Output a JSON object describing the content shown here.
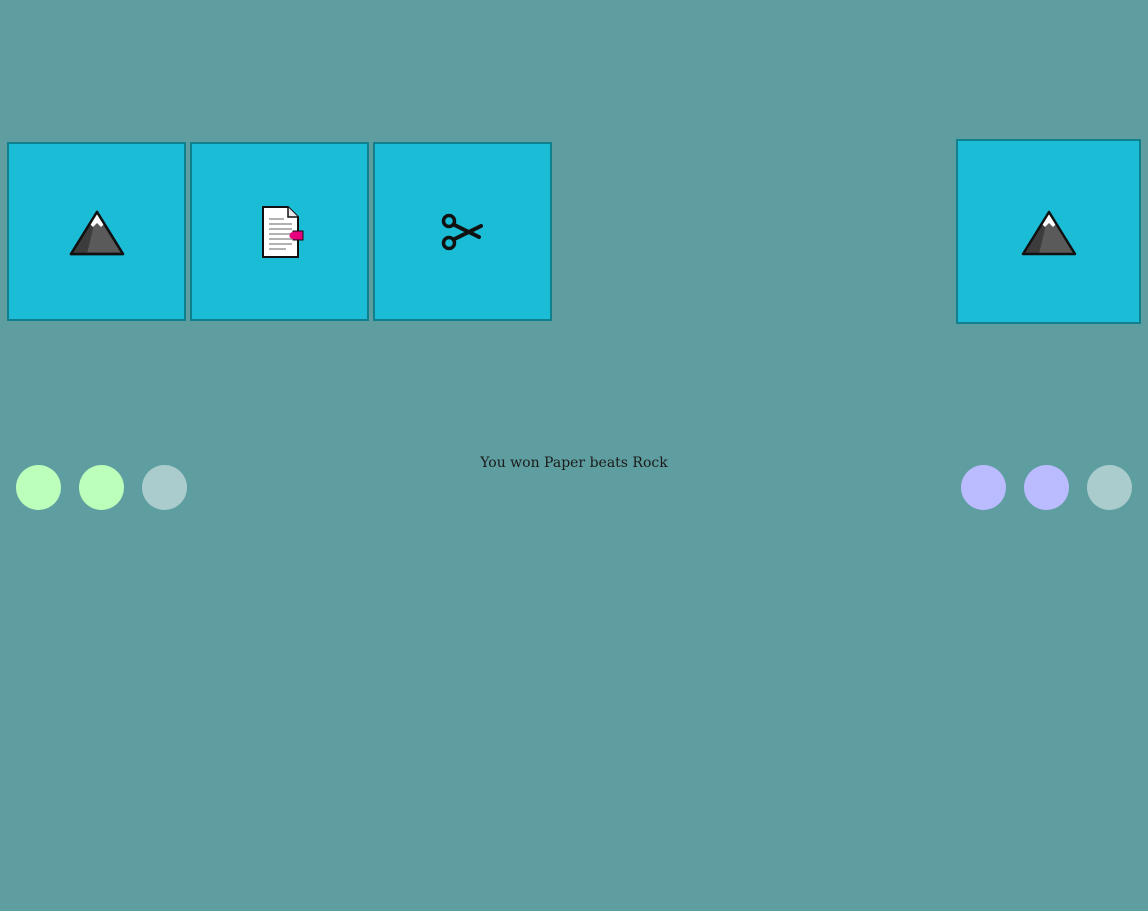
{
  "player": {
    "choices": [
      {
        "name": "Rock",
        "icon": "mountain-icon"
      },
      {
        "name": "Paper",
        "icon": "page-icon"
      },
      {
        "name": "Scissors",
        "icon": "scissors-icon"
      }
    ],
    "lives": {
      "total": 3,
      "remaining": 2,
      "color_active": "#bbffbb",
      "color_used": "#aacccc"
    }
  },
  "opponent": {
    "choice": {
      "name": "Rock",
      "icon": "mountain-icon"
    },
    "lives": {
      "total": 3,
      "remaining": 2,
      "color_active": "#bbbbff",
      "color_used": "#aacccc"
    }
  },
  "result": {
    "message": "You won Paper beats Rock"
  },
  "colors": {
    "background": "#5f9ea0",
    "card_fill": "#1bbdd6",
    "card_border": "#10808f"
  }
}
